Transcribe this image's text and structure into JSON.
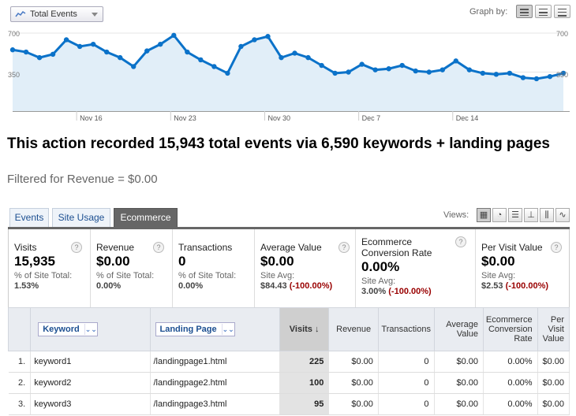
{
  "graph": {
    "metric_label": "Total Events",
    "graph_by_label": "Graph by:",
    "y_label_top": "700",
    "y_label_mid": "350",
    "y_label_top_right": "700",
    "y_label_mid_right": "350",
    "x_labels": [
      "Nov 16",
      "Nov 23",
      "Nov 30",
      "Dec 7",
      "Dec 14"
    ],
    "colors": {
      "line": "#0b72c9",
      "fill": "#e1eef8",
      "axis": "#999999"
    }
  },
  "chart_data": {
    "type": "area",
    "title": "",
    "series": [
      {
        "values": [
          550,
          530,
          480,
          510,
          640,
          580,
          600,
          530,
          480,
          400,
          540,
          600,
          680,
          530,
          460,
          400,
          340,
          580,
          640,
          670,
          480,
          520,
          480,
          410,
          340,
          350,
          420,
          370,
          380,
          410,
          360,
          350,
          370,
          450,
          370,
          340,
          330,
          340,
          300,
          290,
          310,
          340
        ]
      }
    ],
    "ylim": [
      0,
      700
    ],
    "xlabel": "",
    "ylabel": ""
  },
  "headline": "This action recorded 15,943 total events via 6,590 keywords + landing pages",
  "filter_note": "Filtered for Revenue = $0.00",
  "tabs": [
    "Events",
    "Site Usage",
    "Ecommerce"
  ],
  "views_label": "Views:",
  "scorecards": [
    {
      "title": "Visits",
      "value": "15,935",
      "sub": "% of Site Total:",
      "avg": "1.53%",
      "neg": ""
    },
    {
      "title": "Revenue",
      "value": "$0.00",
      "sub": "% of Site Total:",
      "avg": "0.00%",
      "neg": ""
    },
    {
      "title": "Transactions",
      "value": "0",
      "sub": "% of Site Total:",
      "avg": "0.00%",
      "neg": ""
    },
    {
      "title": "Average Value",
      "value": "$0.00",
      "sub": "Site Avg:",
      "avg": "$84.43",
      "neg": "(-100.00%)"
    },
    {
      "title": "Ecommerce Conversion Rate",
      "value": "0.00%",
      "sub": "Site Avg:",
      "avg": "3.00%",
      "neg": "(-100.00%)"
    },
    {
      "title": "Per Visit Value",
      "value": "$0.00",
      "sub": "Site Avg:",
      "avg": "$2.53",
      "neg": "(-100.00%)"
    }
  ],
  "table": {
    "dim1": "Keyword",
    "dim2": "Landing Page",
    "headers": [
      "Visits",
      "Revenue",
      "Transactions",
      "Average Value",
      "Ecommerce Conversion Rate",
      "Per Visit Value"
    ],
    "sort_arrow": "↓",
    "rows": [
      {
        "idx": "1.",
        "keyword": "keyword1",
        "page": "/landingpage1.html",
        "visits": "225",
        "revenue": "$0.00",
        "transactions": "0",
        "avg": "$0.00",
        "conv": "0.00%",
        "pvv": "$0.00"
      },
      {
        "idx": "2.",
        "keyword": "keyword2",
        "page": "/landingpage2.html",
        "visits": "100",
        "revenue": "$0.00",
        "transactions": "0",
        "avg": "$0.00",
        "conv": "0.00%",
        "pvv": "$0.00"
      },
      {
        "idx": "3.",
        "keyword": "keyword3",
        "page": "/landingpage3.html",
        "visits": "95",
        "revenue": "$0.00",
        "transactions": "0",
        "avg": "$0.00",
        "conv": "0.00%",
        "pvv": "$0.00"
      }
    ]
  }
}
